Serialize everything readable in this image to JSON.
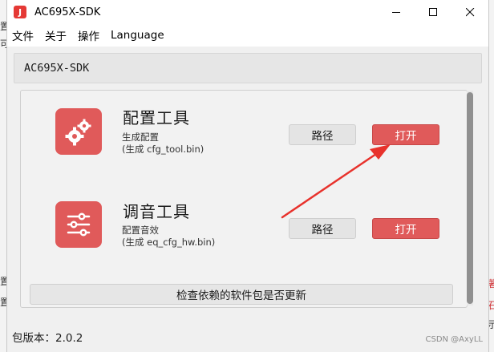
{
  "window": {
    "title": "AC695X-SDK"
  },
  "menu": {
    "items": [
      "文件",
      "关于",
      "操作",
      "Language"
    ]
  },
  "header": {
    "title": "AC695X-SDK"
  },
  "tools": [
    {
      "title": "配置工具",
      "desc1": "生成配置",
      "desc2": "(生成 cfg_tool.bin)",
      "path_label": "路径",
      "open_label": "打开",
      "icon": "gears-icon"
    },
    {
      "title": "调音工具",
      "desc1": "配置音效",
      "desc2": "(生成 eq_cfg_hw.bin)",
      "path_label": "路径",
      "open_label": "打开",
      "icon": "sliders-icon"
    }
  ],
  "check_button": "检查依赖的软件包是否更新",
  "version": "包版本：2.0.2",
  "watermark": "CSDN @AxyLL",
  "background_fragments": {
    "left": [
      "置",
      "可",
      "置",
      "置"
    ],
    "right": [
      "著",
      "石",
      "示"
    ]
  },
  "colors": {
    "accent": "#e05a5a",
    "arrow": "#e8322c"
  }
}
